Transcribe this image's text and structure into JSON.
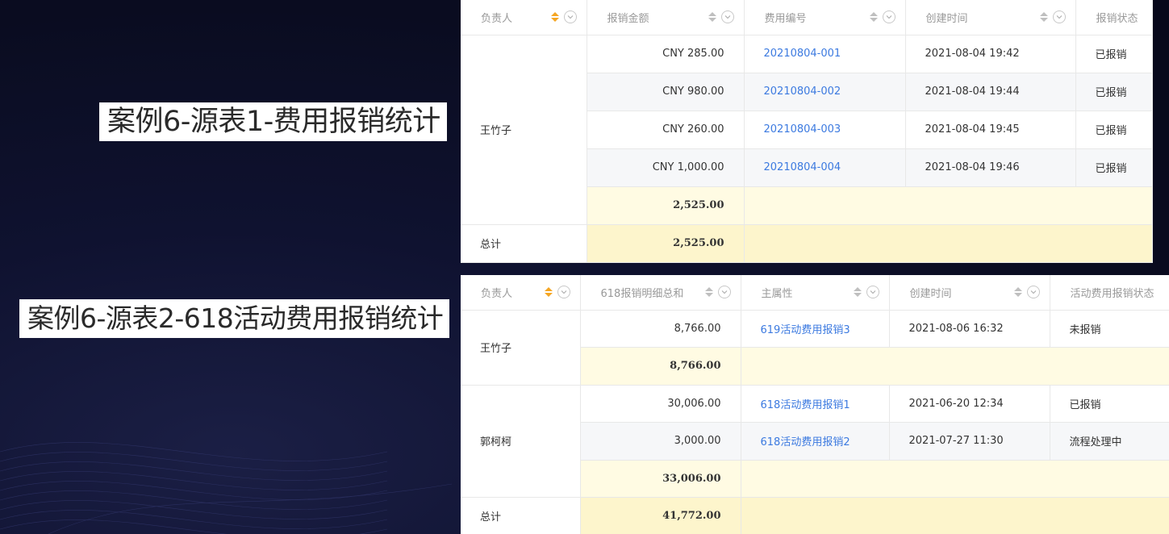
{
  "case1": {
    "title": "案例6-源表1-费用报销统计",
    "columns": [
      "负责人",
      "报销金额",
      "费用编号",
      "创建时间",
      "报销状态"
    ],
    "group_owner": "王竹子",
    "rows": [
      {
        "amount": "CNY 285.00",
        "code": "20210804-001",
        "time": "2021-08-04 19:42",
        "status": "已报销"
      },
      {
        "amount": "CNY 980.00",
        "code": "20210804-002",
        "time": "2021-08-04 19:44",
        "status": "已报销"
      },
      {
        "amount": "CNY 260.00",
        "code": "20210804-003",
        "time": "2021-08-04 19:45",
        "status": "已报销"
      },
      {
        "amount": "CNY 1,000.00",
        "code": "20210804-004",
        "time": "2021-08-04 19:46",
        "status": "已报销"
      }
    ],
    "subtotal": "2,525.00",
    "total_label": "总计",
    "total": "2,525.00"
  },
  "case2": {
    "title": "案例6-源表2-618活动费用报销统计",
    "columns": [
      "负责人",
      "618报销明细总和",
      "主属性",
      "创建时间",
      "活动费用报销状态"
    ],
    "groups": [
      {
        "owner": "王竹子",
        "rows": [
          {
            "amount": "8,766.00",
            "attr": "619活动费用报销3",
            "time": "2021-08-06 16:32",
            "status": "未报销"
          }
        ],
        "subtotal": "8,766.00"
      },
      {
        "owner": "郭柯柯",
        "rows": [
          {
            "amount": "30,006.00",
            "attr": "618活动费用报销1",
            "time": "2021-06-20 12:34",
            "status": "已报销"
          },
          {
            "amount": "3,000.00",
            "attr": "618活动费用报销2",
            "time": "2021-07-27 11:30",
            "status": "流程处理中"
          }
        ],
        "subtotal": "33,006.00"
      }
    ],
    "total_label": "总计",
    "total": "41,772.00"
  },
  "colors": {
    "link": "#3c7ae0",
    "sort_active": "#f5a623",
    "subtotal_bg": "#fffbe3",
    "total_bg": "#fdf5cc"
  }
}
